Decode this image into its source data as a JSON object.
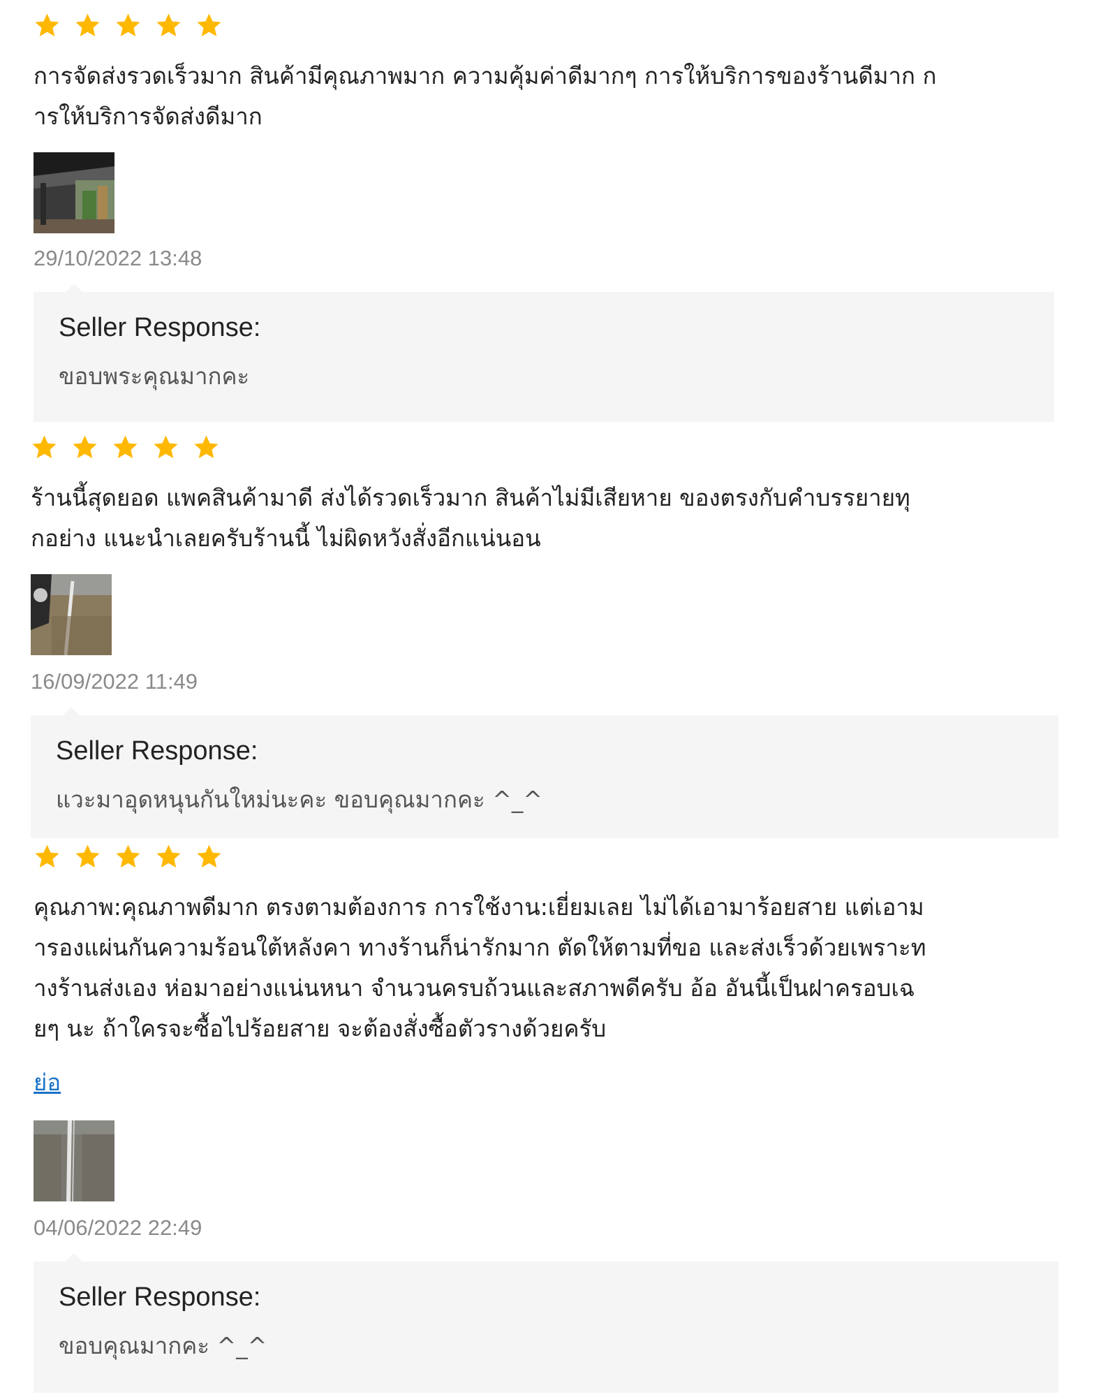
{
  "colors": {
    "star": "#ffb800",
    "link": "#1a73c8",
    "response_bg": "#f5f5f5",
    "timestamp": "#8a8a8a"
  },
  "reviews": [
    {
      "rating": 5,
      "text": "การจัดส่งรวดเร็วมาก สินค้ามีคุณภาพมาก ความคุ้มค่าดีมากๆ การให้บริการของร้านดีมาก ก\nารให้บริการจัดส่งดีมาก",
      "photo": "review-photo-icon",
      "timestamp": "29/10/2022 13:48",
      "seller_response": {
        "title": "Seller Response:",
        "text": "ขอบพระคุณมากคะ"
      }
    },
    {
      "rating": 5,
      "text": "ร้านนี้สุดยอด แพคสินค้ามาดี ส่งได้รวดเร็วมาก สินค้าไม่มีเสียหาย ของตรงกับคำบรรยายทุ\nกอย่าง แนะนำเลยครับร้านนี้ ไม่ผิดหวังสั่งอีกแน่นอน",
      "photo": "review-photo-icon",
      "timestamp": "16/09/2022 11:49",
      "seller_response": {
        "title": "Seller Response:",
        "text": "แวะมาอุดหนุนกันใหม่นะคะ ขอบคุณมากคะ ^_^"
      }
    },
    {
      "rating": 5,
      "text": "คุณภาพ:คุณภาพดีมาก ตรงตามต้องการ การใช้งาน:เยี่ยมเลย ไม่ได้เอามาร้อยสาย แต่เอาม\nารองแผ่นกันความร้อนใต้หลังคา ทางร้านก็น่ารักมาก ตัดให้ตามที่ขอ และส่งเร็วด้วยเพราะท\nางร้านส่งเอง ห่อมาอย่างแน่นหนา จำนวนครบถ้วนและสภาพดีครับ อ้อ อันนี้เป็นฝาครอบเฉ\nยๆ นะ ถ้าใครจะซื้อไปร้อยสาย จะต้องสั่งซื้อตัวรางด้วยครับ",
      "collapse_label": "ย่อ",
      "photo": "review-photo-icon",
      "timestamp": "04/06/2022 22:49",
      "seller_response": {
        "title": "Seller Response:",
        "text": "ขอบคุณมากคะ ^_^"
      }
    }
  ]
}
